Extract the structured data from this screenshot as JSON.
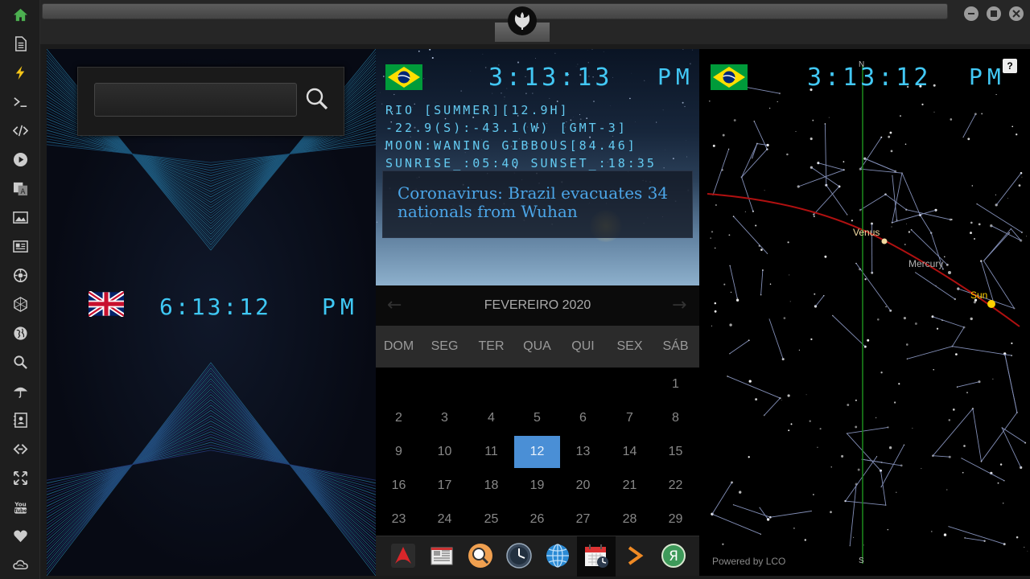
{
  "rail": {
    "items": [
      {
        "name": "home-icon",
        "color": "#4caf50"
      },
      {
        "name": "document-icon"
      },
      {
        "name": "lightning-icon",
        "color": "#f5c518"
      },
      {
        "name": "terminal-icon"
      },
      {
        "name": "code-icon"
      },
      {
        "name": "play-icon"
      },
      {
        "name": "translate-icon"
      },
      {
        "name": "image-icon"
      },
      {
        "name": "news-icon"
      },
      {
        "name": "settings-cog-icon"
      },
      {
        "name": "hexagon-network-icon"
      },
      {
        "name": "globe-icon"
      },
      {
        "name": "search-icon"
      },
      {
        "name": "umbrella-icon"
      },
      {
        "name": "contacts-icon"
      },
      {
        "name": "link-icon"
      },
      {
        "name": "expand-icon"
      },
      {
        "name": "youtube-icon",
        "label": "You Tube"
      },
      {
        "name": "heart-icon"
      },
      {
        "name": "cloud-icon"
      }
    ]
  },
  "search": {
    "value": "",
    "placeholder": ""
  },
  "uk_clock": {
    "time": "6:13:12",
    "ampm": "PM",
    "flag": "uk-flag"
  },
  "rio_clock": {
    "time": "3:13:13",
    "ampm": "PM",
    "flag": "brazil-flag"
  },
  "rio_info": {
    "line1": "RIO [SUMMER][12.9H]",
    "line2": "-22.9(S):-43.1(W) [GMT-3]",
    "line3": "MOON:WANING GIBBOUS[84.46]",
    "line4": "SUNRISE_:05:40 SUNSET_:18:35"
  },
  "news": {
    "headline": "Coronavirus: Brazil evacuates 34 nationals from Wuhan"
  },
  "calendar": {
    "title": "FEVEREIRO 2020",
    "prev": "←",
    "next": "→",
    "weekdays": [
      "DOM",
      "SEG",
      "TER",
      "QUA",
      "QUI",
      "SEX",
      "SÁB"
    ],
    "today": "12",
    "weeks": [
      [
        "",
        "",
        "",
        "",
        "",
        "",
        "1"
      ],
      [
        "2",
        "3",
        "4",
        "5",
        "6",
        "7",
        "8"
      ],
      [
        "9",
        "10",
        "11",
        "12",
        "13",
        "14",
        "15"
      ],
      [
        "16",
        "17",
        "18",
        "19",
        "20",
        "21",
        "22"
      ],
      [
        "23",
        "24",
        "25",
        "26",
        "27",
        "28",
        "29"
      ]
    ]
  },
  "dock": {
    "items": [
      {
        "name": "arch-app-icon"
      },
      {
        "name": "newspaper-app-icon"
      },
      {
        "name": "search-app-icon"
      },
      {
        "name": "clock-app-icon"
      },
      {
        "name": "browser-app-icon"
      },
      {
        "name": "calendar-app-icon",
        "active": true
      },
      {
        "name": "terminal-app-icon"
      },
      {
        "name": "yandex-app-icon",
        "label": "Я"
      }
    ]
  },
  "sky": {
    "time": "3:13:12",
    "ampm": "PM",
    "north": "N",
    "south": "S",
    "help": "?",
    "planets": [
      {
        "name": "Venus",
        "color": "#f0d9a0"
      },
      {
        "name": "Mercury",
        "color": "#b0b0b0"
      },
      {
        "name": "Sun",
        "color": "#ffd000"
      }
    ],
    "powered_by": "Powered by LCO"
  },
  "colors": {
    "digital": "#42c8f5",
    "today": "#4a8fd6",
    "ecliptic": "#b01010",
    "meridian": "#1c8a1c"
  }
}
